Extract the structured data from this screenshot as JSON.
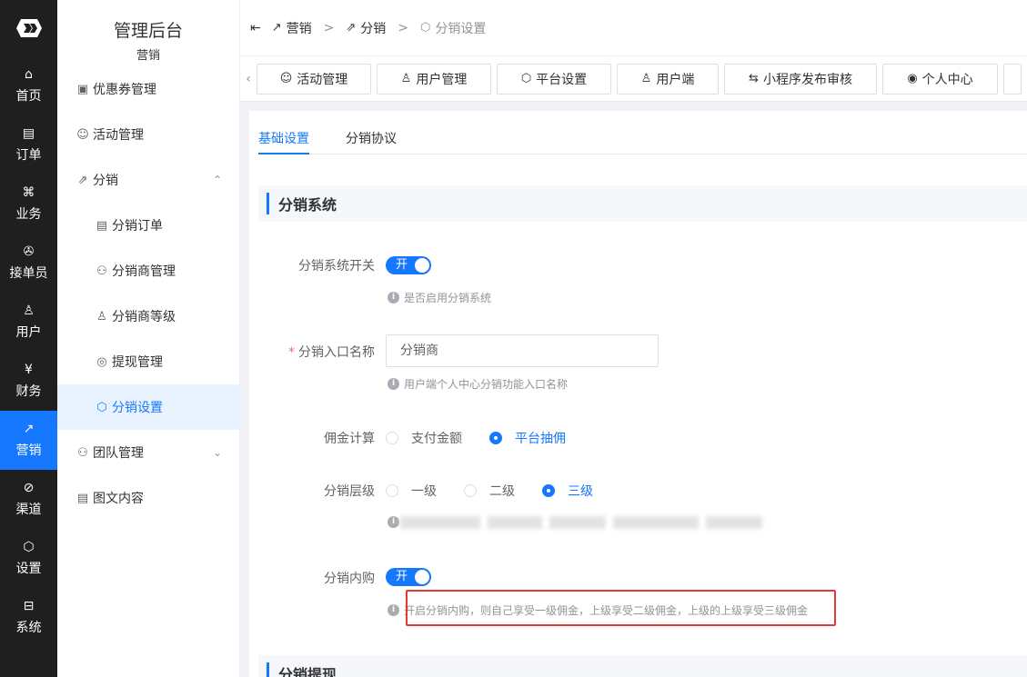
{
  "app": {
    "title": "管理后台",
    "subtitle": "营销"
  },
  "nav": [
    {
      "label": "首页",
      "icon": "home-icon",
      "glyph": "⌂"
    },
    {
      "label": "订单",
      "icon": "order-icon",
      "glyph": "▤"
    },
    {
      "label": "业务",
      "icon": "business-icon",
      "glyph": "⌘"
    },
    {
      "label": "接单员",
      "icon": "bike-icon",
      "glyph": "✇"
    },
    {
      "label": "用户",
      "icon": "user-icon",
      "glyph": "♙"
    },
    {
      "label": "财务",
      "icon": "finance-icon",
      "glyph": "¥"
    },
    {
      "label": "营销",
      "icon": "chart-icon",
      "glyph": "↗",
      "active": true
    },
    {
      "label": "渠道",
      "icon": "channel-icon",
      "glyph": "⊘"
    },
    {
      "label": "设置",
      "icon": "settings-icon",
      "glyph": "⬡"
    },
    {
      "label": "系统",
      "icon": "system-icon",
      "glyph": "⊟"
    }
  ],
  "sidebar": {
    "items": [
      {
        "label": "优惠券管理",
        "icon": "coupon-icon",
        "glyph": "▣"
      },
      {
        "label": "活动管理",
        "icon": "smile-icon",
        "glyph": "☺"
      },
      {
        "label": "分销",
        "icon": "share-icon",
        "glyph": "⇗",
        "arrow": "⌃"
      },
      {
        "label": "分销订单",
        "icon": "document-icon",
        "glyph": "▤"
      },
      {
        "label": "分销商管理",
        "icon": "team-icon",
        "glyph": "⚇"
      },
      {
        "label": "分销商等级",
        "icon": "user-level-icon",
        "glyph": "♙"
      },
      {
        "label": "提现管理",
        "icon": "withdraw-icon",
        "glyph": "◎"
      },
      {
        "label": "分销设置",
        "icon": "settings-icon",
        "glyph": "⬡"
      },
      {
        "label": "团队管理",
        "icon": "team-icon",
        "glyph": "⚇",
        "arrow": "⌄"
      },
      {
        "label": "图文内容",
        "icon": "article-icon",
        "glyph": "▤"
      }
    ]
  },
  "breadcrumb": [
    {
      "label": "营销",
      "glyph": "↗"
    },
    {
      "label": "分销",
      "glyph": "⇗"
    },
    {
      "label": "分销设置",
      "glyph": "⬡"
    }
  ],
  "breadcrumb_collapse": "⇤",
  "tabs": [
    {
      "label": "活动管理",
      "icon": "smile-icon",
      "glyph": "☺"
    },
    {
      "label": "用户管理",
      "icon": "user-icon",
      "glyph": "♙"
    },
    {
      "label": "平台设置",
      "icon": "settings-icon",
      "glyph": "⬡"
    },
    {
      "label": "用户端",
      "icon": "user-icon",
      "glyph": "♙"
    },
    {
      "label": "小程序发布审核",
      "icon": "swap-icon",
      "glyph": "⇆"
    },
    {
      "label": "个人中心",
      "icon": "location-user-icon",
      "glyph": "◉"
    }
  ],
  "tabs_scroll_left": "‹",
  "subtabs": [
    "基础设置",
    "分销协议"
  ],
  "sections": {
    "distribution_system": "分销系统",
    "distribution_withdraw": "分销提现"
  },
  "form": {
    "system_switch": {
      "label": "分销系统开关",
      "value": "开",
      "hint": "是否启用分销系统"
    },
    "entry_name": {
      "label": "分销入口名称",
      "required_mark": "*",
      "value": "分销商",
      "hint": "用户端个人中心分销功能入口名称"
    },
    "commission": {
      "label": "佣金计算",
      "options": [
        "支付金额",
        "平台抽佣"
      ],
      "selected": "平台抽佣"
    },
    "levels": {
      "label": "分销层级",
      "options": [
        "一级",
        "二级",
        "三级"
      ],
      "selected": "三级"
    },
    "self_purchase": {
      "label": "分销内购",
      "value": "开",
      "hint": "开启分销内购，则自己享受一级佣金，上级享受二级佣金，上级的上级享受三级佣金"
    }
  },
  "info_glyph": "i",
  "colors": {
    "accent": "#1677ff",
    "iconbar": "#1f1f1f",
    "highlight_box": "#e53935"
  }
}
